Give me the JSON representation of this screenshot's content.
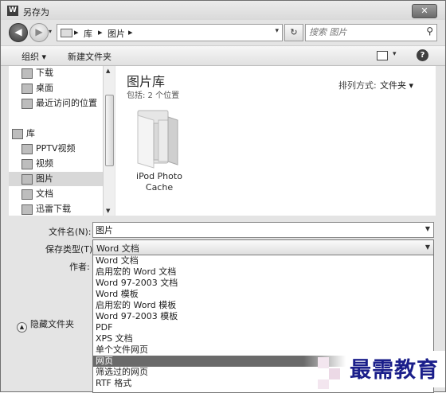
{
  "window": {
    "title": "另存为",
    "app_icon": "W",
    "close_glyph": "✕"
  },
  "nav": {
    "back_glyph": "◀",
    "forward_glyph": "▶",
    "breadcrumb": [
      "库",
      "图片"
    ],
    "separator": "▸",
    "refresh_glyph": "↻",
    "search_placeholder": "搜索 图片",
    "search_glyph": "⚲"
  },
  "toolbar": {
    "organize": "组织 ▾",
    "new_folder": "新建文件夹",
    "help_glyph": "?"
  },
  "sidebar": {
    "items": [
      {
        "label": "下载",
        "group": false,
        "selected": false
      },
      {
        "label": "桌面",
        "group": false,
        "selected": false
      },
      {
        "label": "最近访问的位置",
        "group": false,
        "selected": false
      },
      {
        "label": "库",
        "group": true,
        "selected": false
      },
      {
        "label": "PPTV视频",
        "group": false,
        "selected": false
      },
      {
        "label": "视频",
        "group": false,
        "selected": false
      },
      {
        "label": "图片",
        "group": false,
        "selected": true
      },
      {
        "label": "文档",
        "group": false,
        "selected": false
      },
      {
        "label": "迅雷下载",
        "group": false,
        "selected": false
      }
    ]
  },
  "main": {
    "library_title": "图片库",
    "library_subtitle": "包括: 2 个位置",
    "arrange_label": "排列方式:",
    "arrange_value": "文件夹 ▾",
    "folder": {
      "name_line1": "iPod Photo",
      "name_line2": "Cache"
    }
  },
  "form": {
    "filename_label": "文件名(N):",
    "filename_value": "图片",
    "filetype_label": "保存类型(T):",
    "filetype_value": "Word 文档",
    "author_label": "作者:",
    "options": [
      "Word 文档",
      "启用宏的 Word 文档",
      "Word 97-2003 文档",
      "Word 模板",
      "启用宏的 Word 模板",
      "Word 97-2003 模板",
      "PDF",
      "XPS 文档",
      "单个文件网页",
      "网页",
      "筛选过的网页",
      "RTF 格式"
    ],
    "highlighted_option": "网页",
    "hide_folders": "隐藏文件夹"
  },
  "watermark": {
    "text": "最需教育"
  }
}
